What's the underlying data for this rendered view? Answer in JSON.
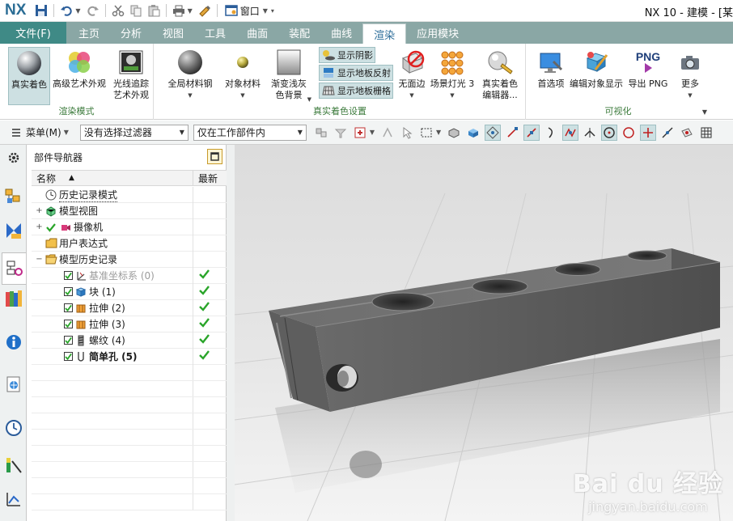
{
  "titlebar": {
    "logo": "NX",
    "window_menu_label": "窗口",
    "app_title": "NX 10 - 建模 - [某"
  },
  "menu": {
    "file_label": "文件(F)",
    "tabs": [
      {
        "label": "主页"
      },
      {
        "label": "分析"
      },
      {
        "label": "视图"
      },
      {
        "label": "工具"
      },
      {
        "label": "曲面"
      },
      {
        "label": "装配"
      },
      {
        "label": "曲线"
      },
      {
        "label": "渲染",
        "active": true
      },
      {
        "label": "应用模块"
      }
    ]
  },
  "ribbon": {
    "groups": {
      "render_mode": "渲染模式",
      "true_shading": "真实着色设置",
      "visualize": "可视化"
    },
    "buttons": {
      "true_shading": "真实着色",
      "advanced_art": "高级艺术外观",
      "raytrace_1": "光线追踪",
      "raytrace_2": "艺术外观",
      "global_material_1": "全局材料钢",
      "object_material": "对象材料",
      "gradient_bg_1": "渐变浅灰",
      "gradient_bg_2": "色背景",
      "show_shadow": "显示阴影",
      "show_floor_reflect": "显示地板反射",
      "show_floor_grid": "显示地板栅格",
      "no_edge": "无面边",
      "scene_light": "场景灯光 3",
      "true_shading_editor_1": "真实着色",
      "true_shading_editor_2": "编辑器...",
      "preferences": "首选项",
      "edit_object_display": "编辑对象显示",
      "export_png": "导出 PNG",
      "png_text": "PNG",
      "more": "更多"
    }
  },
  "selection_bar": {
    "menu_label": "菜单(M)",
    "filter_value": "没有选择过滤器",
    "scope_value": "仅在工作部件内"
  },
  "navigator": {
    "title": "部件导航器",
    "col_name": "名称",
    "col_latest": "最新",
    "rows": [
      {
        "label": "历史记录模式",
        "icon": "clock-icon",
        "indent": 1,
        "expander": "",
        "checkbox": false,
        "latest": false,
        "style": "dotted"
      },
      {
        "label": "模型视图",
        "icon": "model-view-icon",
        "indent": 0,
        "expander": "+",
        "checkbox": false,
        "latest": false,
        "style": ""
      },
      {
        "label": "摄像机",
        "icon": "camera-icon",
        "indent": 0,
        "expander": "+",
        "checkbox": false,
        "latest": false,
        "style": "",
        "checkmark": true
      },
      {
        "label": "用户表达式",
        "icon": "folder-icon",
        "indent": 1,
        "expander": "",
        "checkbox": false,
        "latest": false,
        "style": ""
      },
      {
        "label": "模型历史记录",
        "icon": "folder-open-icon",
        "indent": 0,
        "expander": "−",
        "checkbox": false,
        "latest": false,
        "style": ""
      },
      {
        "label": "基准坐标系 (0)",
        "icon": "datum-csys-icon",
        "indent": 2,
        "expander": "",
        "checkbox": true,
        "latest": true,
        "style": "dim"
      },
      {
        "label": "块 (1)",
        "icon": "block-icon",
        "indent": 2,
        "expander": "",
        "checkbox": true,
        "latest": true,
        "style": ""
      },
      {
        "label": "拉伸 (2)",
        "icon": "extrude-icon",
        "indent": 2,
        "expander": "",
        "checkbox": true,
        "latest": true,
        "style": ""
      },
      {
        "label": "拉伸 (3)",
        "icon": "extrude-icon",
        "indent": 2,
        "expander": "",
        "checkbox": true,
        "latest": true,
        "style": ""
      },
      {
        "label": "螺纹 (4)",
        "icon": "thread-icon",
        "indent": 2,
        "expander": "",
        "checkbox": true,
        "latest": true,
        "style": ""
      },
      {
        "label": "简单孔 (5)",
        "icon": "hole-icon",
        "indent": 2,
        "expander": "",
        "checkbox": true,
        "latest": true,
        "style": "bold"
      }
    ]
  },
  "watermark": {
    "main": "Bai du 经验",
    "sub": "jingyan.baidu.com"
  },
  "colors": {
    "tab_bar": "#8aa7a5",
    "file_tab": "#3f8a86",
    "group_label": "#3b7a3b",
    "check_green": "#2aa52a"
  }
}
